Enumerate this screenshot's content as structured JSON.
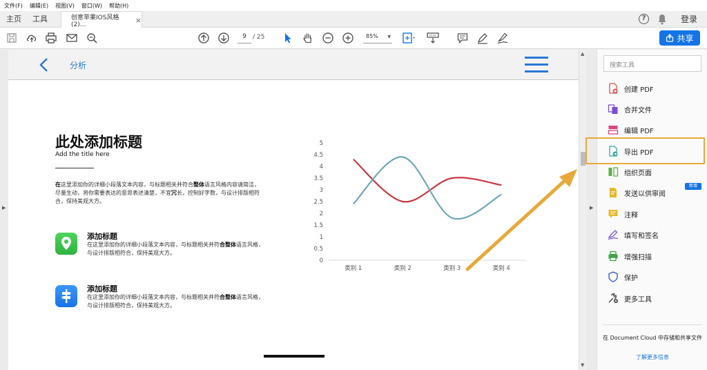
{
  "menubar": [
    "文件(F)",
    "编辑(E)",
    "视图(V)",
    "窗口(W)",
    "帮助(H)"
  ],
  "tabs": {
    "home": "主页",
    "tools": "工具",
    "document": "创意苹果IOS风格(2)...",
    "close": "×",
    "login": "登录"
  },
  "toolbar": {
    "page_current": "9",
    "page_total": "/ 25",
    "zoom": "85%",
    "share_label": "共享"
  },
  "slide": {
    "header_title": "分析",
    "title": "此处添加标题",
    "subtitle": "Add the title here",
    "intro_bold_1": "在",
    "intro_1": "这里添加你的详细小段落文本内容，与标题相关并符合",
    "intro_bold_2": "整体",
    "intro_2": "语言风格内容请简洁，尽量生动，将你需要表达的意思表述清楚，不宜",
    "intro_bold_3": "冗",
    "intro_3": "长，控制好字数，与设计排版相符合，保持美观大方。",
    "features": [
      {
        "title": "添加标题",
        "desc_1": "在这里添加你的详细小段落文本内容，与标题相关并符",
        "desc_bold": "合整体",
        "desc_2": "语言风格，与设计排版相符合，保持美观大方。",
        "icon": "location-pin-icon",
        "color": "#3cc94f"
      },
      {
        "title": "添加标题",
        "desc_1": "在这里添加你的详细小段落文本内容，与标题相关并符",
        "desc_bold": "合整体",
        "desc_2": "语言风格，与设计排版相符合，保持美观大方。",
        "icon": "signpost-icon",
        "color": "#1e7ff0"
      }
    ]
  },
  "chart_data": {
    "type": "line",
    "categories": [
      "类别 1",
      "类别 2",
      "类别 3",
      "类别 4"
    ],
    "y_ticks": [
      "0",
      "0.5",
      "1",
      "1.5",
      "2",
      "2.5",
      "3",
      "3.5",
      "4",
      "4.5",
      "5"
    ],
    "ylim": [
      0,
      5
    ],
    "smooth": true,
    "grid": false,
    "series": [
      {
        "values": [
          4.3,
          2.5,
          3.5,
          3.2
        ],
        "color": "#c9373f"
      },
      {
        "values": [
          2.4,
          4.4,
          1.8,
          2.8
        ],
        "color": "#6fa7b8"
      }
    ]
  },
  "right_panel": {
    "search_placeholder": "搜索工具",
    "tools": [
      {
        "label": "创建 PDF",
        "icon": "create-pdf-icon",
        "color": "#e0534f"
      },
      {
        "label": "合并文件",
        "icon": "combine-files-icon",
        "color": "#7b4fd8"
      },
      {
        "label": "编辑 PDF",
        "icon": "edit-pdf-icon",
        "color": "#d9467e"
      },
      {
        "label": "导出 PDF",
        "icon": "export-pdf-icon",
        "color": "#3aa6a0"
      },
      {
        "label": "组织页面",
        "icon": "organize-pages-icon",
        "color": "#5bb246"
      },
      {
        "label": "发送以供审阅",
        "icon": "send-review-icon",
        "color": "#e5b92a"
      },
      {
        "label": "注释",
        "icon": "comment-icon",
        "color": "#e5b92a"
      },
      {
        "label": "填写和签名",
        "icon": "fill-sign-icon",
        "color": "#7b4fd8"
      },
      {
        "label": "增强扫描",
        "icon": "enhance-scan-icon",
        "color": "#3ca345"
      },
      {
        "label": "保护",
        "icon": "protect-icon",
        "color": "#3b5fcf"
      },
      {
        "label": "更多工具",
        "icon": "more-tools-icon",
        "color": "#444444"
      }
    ],
    "new_badge": "新增",
    "dc_text": "在 Document Cloud 中存储和共享文件",
    "dc_link": "了解更多信息"
  },
  "colors": {
    "accent": "#1473e6",
    "highlight": "#e8a93a"
  }
}
